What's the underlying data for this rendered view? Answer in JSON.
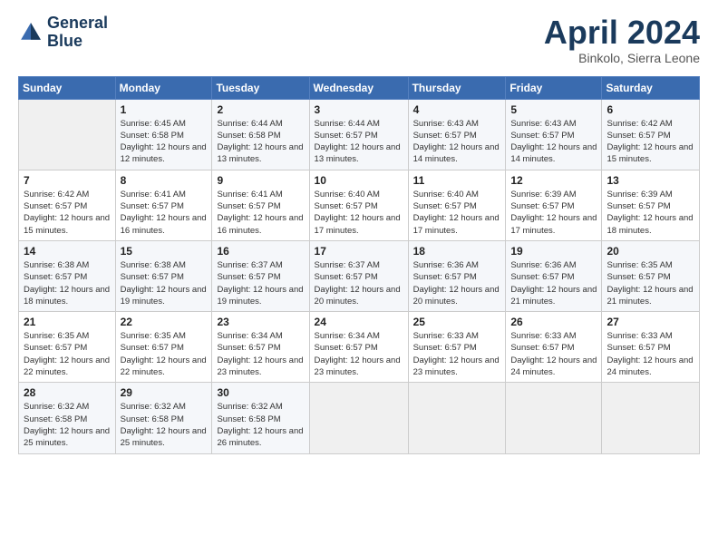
{
  "header": {
    "logo_line1": "General",
    "logo_line2": "Blue",
    "month_title": "April 2024",
    "subtitle": "Binkolo, Sierra Leone"
  },
  "weekdays": [
    "Sunday",
    "Monday",
    "Tuesday",
    "Wednesday",
    "Thursday",
    "Friday",
    "Saturday"
  ],
  "weeks": [
    [
      {
        "day": "",
        "sunrise": "",
        "sunset": "",
        "daylight": ""
      },
      {
        "day": "1",
        "sunrise": "Sunrise: 6:45 AM",
        "sunset": "Sunset: 6:58 PM",
        "daylight": "Daylight: 12 hours and 12 minutes."
      },
      {
        "day": "2",
        "sunrise": "Sunrise: 6:44 AM",
        "sunset": "Sunset: 6:58 PM",
        "daylight": "Daylight: 12 hours and 13 minutes."
      },
      {
        "day": "3",
        "sunrise": "Sunrise: 6:44 AM",
        "sunset": "Sunset: 6:57 PM",
        "daylight": "Daylight: 12 hours and 13 minutes."
      },
      {
        "day": "4",
        "sunrise": "Sunrise: 6:43 AM",
        "sunset": "Sunset: 6:57 PM",
        "daylight": "Daylight: 12 hours and 14 minutes."
      },
      {
        "day": "5",
        "sunrise": "Sunrise: 6:43 AM",
        "sunset": "Sunset: 6:57 PM",
        "daylight": "Daylight: 12 hours and 14 minutes."
      },
      {
        "day": "6",
        "sunrise": "Sunrise: 6:42 AM",
        "sunset": "Sunset: 6:57 PM",
        "daylight": "Daylight: 12 hours and 15 minutes."
      }
    ],
    [
      {
        "day": "7",
        "sunrise": "Sunrise: 6:42 AM",
        "sunset": "Sunset: 6:57 PM",
        "daylight": "Daylight: 12 hours and 15 minutes."
      },
      {
        "day": "8",
        "sunrise": "Sunrise: 6:41 AM",
        "sunset": "Sunset: 6:57 PM",
        "daylight": "Daylight: 12 hours and 16 minutes."
      },
      {
        "day": "9",
        "sunrise": "Sunrise: 6:41 AM",
        "sunset": "Sunset: 6:57 PM",
        "daylight": "Daylight: 12 hours and 16 minutes."
      },
      {
        "day": "10",
        "sunrise": "Sunrise: 6:40 AM",
        "sunset": "Sunset: 6:57 PM",
        "daylight": "Daylight: 12 hours and 17 minutes."
      },
      {
        "day": "11",
        "sunrise": "Sunrise: 6:40 AM",
        "sunset": "Sunset: 6:57 PM",
        "daylight": "Daylight: 12 hours and 17 minutes."
      },
      {
        "day": "12",
        "sunrise": "Sunrise: 6:39 AM",
        "sunset": "Sunset: 6:57 PM",
        "daylight": "Daylight: 12 hours and 17 minutes."
      },
      {
        "day": "13",
        "sunrise": "Sunrise: 6:39 AM",
        "sunset": "Sunset: 6:57 PM",
        "daylight": "Daylight: 12 hours and 18 minutes."
      }
    ],
    [
      {
        "day": "14",
        "sunrise": "Sunrise: 6:38 AM",
        "sunset": "Sunset: 6:57 PM",
        "daylight": "Daylight: 12 hours and 18 minutes."
      },
      {
        "day": "15",
        "sunrise": "Sunrise: 6:38 AM",
        "sunset": "Sunset: 6:57 PM",
        "daylight": "Daylight: 12 hours and 19 minutes."
      },
      {
        "day": "16",
        "sunrise": "Sunrise: 6:37 AM",
        "sunset": "Sunset: 6:57 PM",
        "daylight": "Daylight: 12 hours and 19 minutes."
      },
      {
        "day": "17",
        "sunrise": "Sunrise: 6:37 AM",
        "sunset": "Sunset: 6:57 PM",
        "daylight": "Daylight: 12 hours and 20 minutes."
      },
      {
        "day": "18",
        "sunrise": "Sunrise: 6:36 AM",
        "sunset": "Sunset: 6:57 PM",
        "daylight": "Daylight: 12 hours and 20 minutes."
      },
      {
        "day": "19",
        "sunrise": "Sunrise: 6:36 AM",
        "sunset": "Sunset: 6:57 PM",
        "daylight": "Daylight: 12 hours and 21 minutes."
      },
      {
        "day": "20",
        "sunrise": "Sunrise: 6:35 AM",
        "sunset": "Sunset: 6:57 PM",
        "daylight": "Daylight: 12 hours and 21 minutes."
      }
    ],
    [
      {
        "day": "21",
        "sunrise": "Sunrise: 6:35 AM",
        "sunset": "Sunset: 6:57 PM",
        "daylight": "Daylight: 12 hours and 22 minutes."
      },
      {
        "day": "22",
        "sunrise": "Sunrise: 6:35 AM",
        "sunset": "Sunset: 6:57 PM",
        "daylight": "Daylight: 12 hours and 22 minutes."
      },
      {
        "day": "23",
        "sunrise": "Sunrise: 6:34 AM",
        "sunset": "Sunset: 6:57 PM",
        "daylight": "Daylight: 12 hours and 23 minutes."
      },
      {
        "day": "24",
        "sunrise": "Sunrise: 6:34 AM",
        "sunset": "Sunset: 6:57 PM",
        "daylight": "Daylight: 12 hours and 23 minutes."
      },
      {
        "day": "25",
        "sunrise": "Sunrise: 6:33 AM",
        "sunset": "Sunset: 6:57 PM",
        "daylight": "Daylight: 12 hours and 23 minutes."
      },
      {
        "day": "26",
        "sunrise": "Sunrise: 6:33 AM",
        "sunset": "Sunset: 6:57 PM",
        "daylight": "Daylight: 12 hours and 24 minutes."
      },
      {
        "day": "27",
        "sunrise": "Sunrise: 6:33 AM",
        "sunset": "Sunset: 6:57 PM",
        "daylight": "Daylight: 12 hours and 24 minutes."
      }
    ],
    [
      {
        "day": "28",
        "sunrise": "Sunrise: 6:32 AM",
        "sunset": "Sunset: 6:58 PM",
        "daylight": "Daylight: 12 hours and 25 minutes."
      },
      {
        "day": "29",
        "sunrise": "Sunrise: 6:32 AM",
        "sunset": "Sunset: 6:58 PM",
        "daylight": "Daylight: 12 hours and 25 minutes."
      },
      {
        "day": "30",
        "sunrise": "Sunrise: 6:32 AM",
        "sunset": "Sunset: 6:58 PM",
        "daylight": "Daylight: 12 hours and 26 minutes."
      },
      {
        "day": "",
        "sunrise": "",
        "sunset": "",
        "daylight": ""
      },
      {
        "day": "",
        "sunrise": "",
        "sunset": "",
        "daylight": ""
      },
      {
        "day": "",
        "sunrise": "",
        "sunset": "",
        "daylight": ""
      },
      {
        "day": "",
        "sunrise": "",
        "sunset": "",
        "daylight": ""
      }
    ]
  ]
}
